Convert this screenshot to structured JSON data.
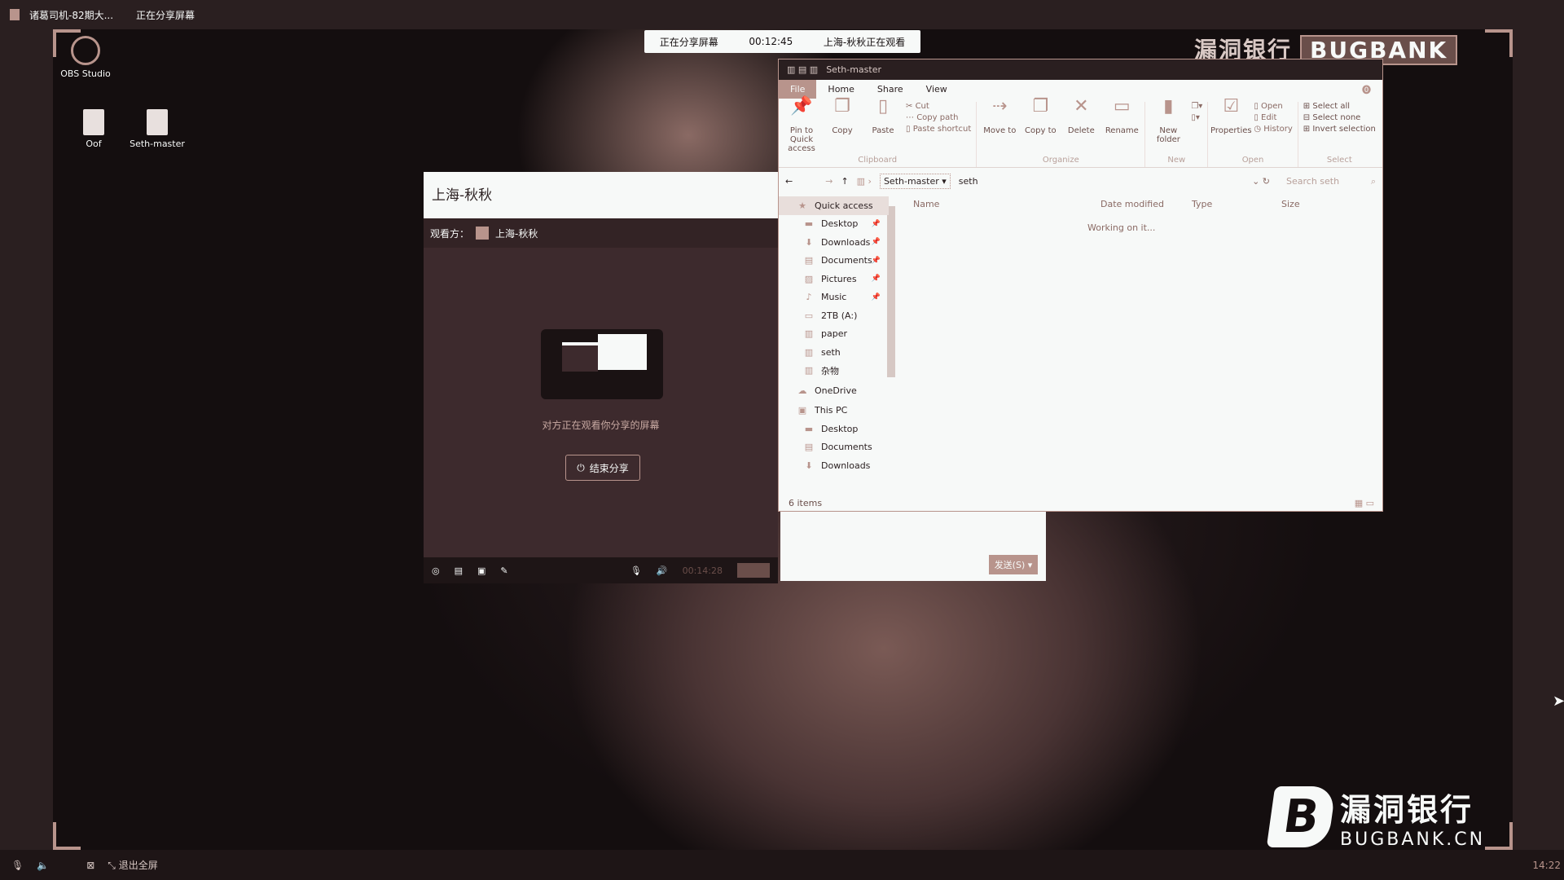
{
  "topbar": {
    "meeting_title": "诸葛司机-82期大...",
    "sharing_status": "正在分享屏幕"
  },
  "banner": {
    "status": "正在分享屏幕",
    "timer": "00:12:45",
    "viewer_notice": "上海-秋秋正在观看"
  },
  "desktop_icons": [
    {
      "label": "OBS Studio"
    },
    {
      "label": "Oof"
    },
    {
      "label": "Seth-master"
    }
  ],
  "share_window": {
    "title": "上海-秋秋",
    "viewer_label": "观看方：",
    "viewer_name": "上海-秋秋",
    "message": "对方正在观看你分享的屏幕",
    "end_button": "结束分享",
    "toolbar_timer": "00:14:28"
  },
  "explorer": {
    "title": "Seth-master",
    "tabs": [
      "File",
      "Home",
      "Share",
      "View"
    ],
    "ribbon": {
      "clipboard": {
        "label": "Clipboard",
        "pin": "Pin to Quick access",
        "copy": "Copy",
        "paste": "Paste",
        "cut": "Cut",
        "copy_path": "Copy path",
        "paste_shortcut": "Paste shortcut"
      },
      "organize": {
        "label": "Organize",
        "move_to": "Move to",
        "copy_to": "Copy to",
        "delete": "Delete",
        "rename": "Rename"
      },
      "new": {
        "label": "New",
        "new_folder": "New folder"
      },
      "open": {
        "label": "Open",
        "properties": "Properties",
        "open": "Open",
        "edit": "Edit",
        "history": "History"
      },
      "select": {
        "label": "Select",
        "select_all": "Select all",
        "select_none": "Select none",
        "invert": "Invert selection"
      }
    },
    "breadcrumb": [
      "Seth-master",
      "seth"
    ],
    "search_placeholder": "Search seth",
    "columns": [
      "Name",
      "Date modified",
      "Type",
      "Size"
    ],
    "loading_text": "Working on it...",
    "nav": [
      {
        "label": "Quick access",
        "icon": "star-icon",
        "top": true
      },
      {
        "label": "Desktop",
        "icon": "desktop-icon",
        "pinned": true
      },
      {
        "label": "Downloads",
        "icon": "download-icon",
        "pinned": true
      },
      {
        "label": "Documents",
        "icon": "document-icon",
        "pinned": true
      },
      {
        "label": "Pictures",
        "icon": "picture-icon",
        "pinned": true
      },
      {
        "label": "Music",
        "icon": "music-icon",
        "pinned": true
      },
      {
        "label": "2TB (A:)",
        "icon": "drive-icon"
      },
      {
        "label": "paper",
        "icon": "folder-icon"
      },
      {
        "label": "seth",
        "icon": "folder-icon"
      },
      {
        "label": "杂物",
        "icon": "folder-icon"
      },
      {
        "label": "OneDrive",
        "icon": "cloud-icon",
        "top": true
      },
      {
        "label": "This PC",
        "icon": "computer-icon",
        "top": true
      },
      {
        "label": "Desktop",
        "icon": "desktop-icon"
      },
      {
        "label": "Documents",
        "icon": "document-icon"
      },
      {
        "label": "Downloads",
        "icon": "download-icon"
      }
    ],
    "status": "6 items"
  },
  "sub_dialog": {
    "button": "发送(S)"
  },
  "watermark": {
    "top_text": "漏洞银行",
    "top_badge": "BUGBANK",
    "logo_cn": "漏洞银行",
    "logo_en": "BUGBANK.CN"
  },
  "bottombar": {
    "exit_fullscreen": "退出全屏",
    "clock": "14:22"
  },
  "colors": {
    "light": "#f7f9f8",
    "accent": "#b8948c",
    "dark": "#140e0f",
    "panel": "#3d2a2d"
  }
}
